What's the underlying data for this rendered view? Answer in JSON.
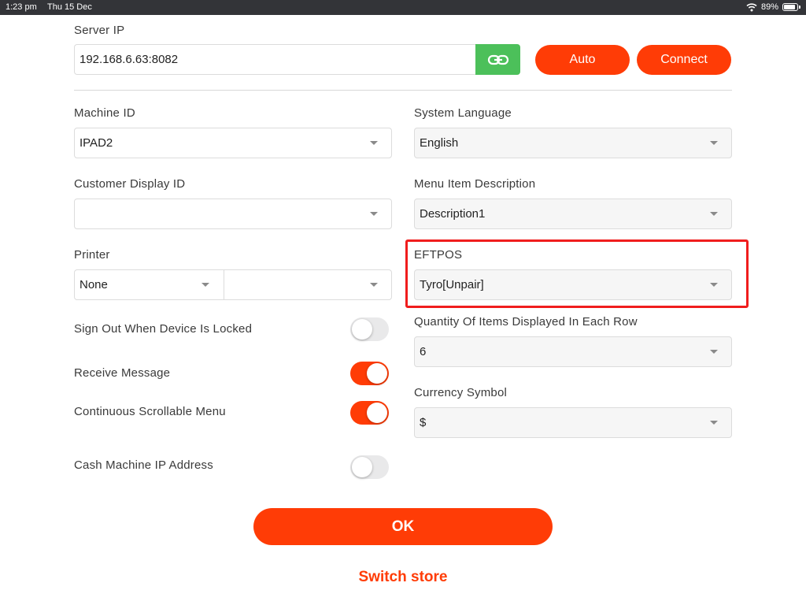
{
  "status_bar": {
    "time": "1:23 pm",
    "date": "Thu 15 Dec",
    "battery_percent": "89%",
    "battery_level": 0.89
  },
  "server": {
    "label": "Server IP",
    "value": "192.168.6.63:8082",
    "link_icon": "link-icon",
    "auto_label": "Auto",
    "connect_label": "Connect"
  },
  "fields": {
    "machine_id": {
      "label": "Machine ID",
      "value": "IPAD2"
    },
    "system_language": {
      "label": "System Language",
      "value": "English"
    },
    "customer_display_id": {
      "label": "Customer Display ID",
      "value": ""
    },
    "menu_item_description": {
      "label": "Menu Item Description",
      "value": "Description1"
    },
    "printer": {
      "label": "Printer",
      "value": "None",
      "value2": ""
    },
    "eftpos": {
      "label": "EFTPOS",
      "value": "Tyro[Unpair]"
    },
    "quantity_per_row": {
      "label": "Quantity Of Items Displayed In Each Row",
      "value": "6"
    },
    "currency_symbol": {
      "label": "Currency Symbol",
      "value": "$"
    }
  },
  "toggles": {
    "sign_out": {
      "label": "Sign Out When Device Is Locked",
      "on": false
    },
    "receive_message": {
      "label": "Receive Message",
      "on": true
    },
    "continuous_scroll": {
      "label": "Continuous Scrollable Menu",
      "on": true
    },
    "cash_machine_ip": {
      "label": "Cash Machine IP Address",
      "on": false
    }
  },
  "actions": {
    "ok_label": "OK",
    "switch_store_label": "Switch store"
  },
  "colors": {
    "accent": "#ff3c06",
    "link_button": "#4cc05a",
    "highlight": "#f01d1d",
    "status_bar": "#333438"
  }
}
